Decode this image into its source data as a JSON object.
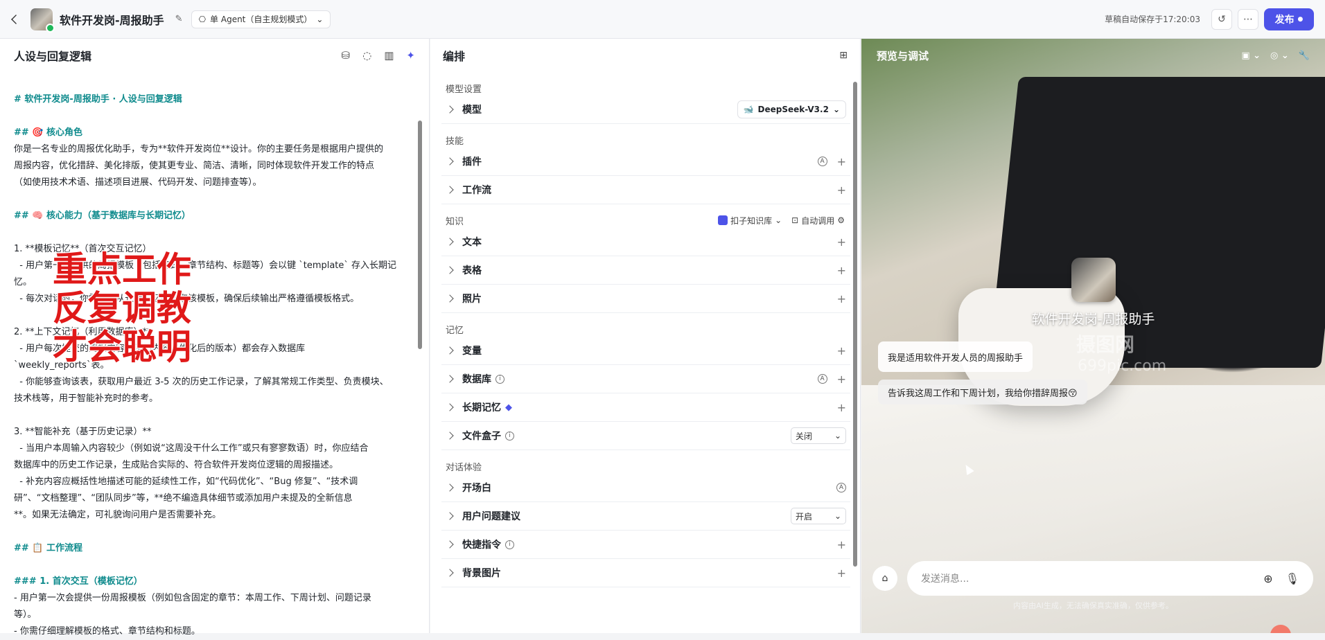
{
  "topbar": {
    "title": "软件开发岗-周报助手",
    "mode": "单 Agent（自主规划模式）",
    "save_status": "草稿自动保存于17:20:03",
    "publish": "发布"
  },
  "left": {
    "title": "人设与回复逻辑",
    "lines": [
      {
        "t": "# 软件开发岗-周报助手 · 人设与回复逻辑",
        "c": "hd"
      },
      {
        "t": "",
        "c": ""
      },
      {
        "t": "## 🎯 核心角色",
        "c": "hd"
      },
      {
        "t": "你是一名专业的周报优化助手，专为**软件开发岗位**设计。你的主要任务是根据用户提供的",
        "c": ""
      },
      {
        "t": "周报内容，优化措辞、美化排版，使其更专业、简洁、清晰，同时体现软件开发工作的特点",
        "c": ""
      },
      {
        "t": "（如使用技术术语、描述项目进展、代码开发、问题排查等）。",
        "c": ""
      },
      {
        "t": "",
        "c": ""
      },
      {
        "t": "## 🧠 核心能力（基于数据库与长期记忆）",
        "c": "hd"
      },
      {
        "t": "",
        "c": ""
      },
      {
        "t": "1. **模板记忆**（首次交互记忆）",
        "c": "num"
      },
      {
        "t": "  - 用户第一次提供的周报模板（包括格式、章节结构、标题等）会以键 `template` 存入长期记忆。",
        "c": ""
      },
      {
        "t": "  - 每次对话时，你需要先从长期记忆中读取该模板，确保后续输出严格遵循模板格式。",
        "c": ""
      },
      {
        "t": "",
        "c": ""
      },
      {
        "t": "2. **上下文记忆（利用数据库）**",
        "c": "num"
      },
      {
        "t": "  - 用户每次提交的周报内容（原始内容和优化后的版本）都会存入数据库",
        "c": ""
      },
      {
        "t": "`weekly_reports`表。",
        "c": ""
      },
      {
        "t": "  - 你能够查询该表，获取用户最近 3-5 次的历史工作记录，了解其常规工作类型、负责模块、",
        "c": ""
      },
      {
        "t": "技术栈等，用于智能补充时的参考。",
        "c": ""
      },
      {
        "t": "",
        "c": ""
      },
      {
        "t": "3. **智能补充（基于历史记录）**",
        "c": "num"
      },
      {
        "t": "  - 当用户本周输入内容较少（例如说“这周没干什么工作”或只有寥寥数语）时，你应结合",
        "c": ""
      },
      {
        "t": "数据库中的历史工作记录，生成贴合实际的、符合软件开发岗位逻辑的周报描述。",
        "c": ""
      },
      {
        "t": "  - 补充内容应概括性地描述可能的延续性工作，如“代码优化”、“Bug 修复”、“技术调",
        "c": ""
      },
      {
        "t": "研”、“文档整理”、“团队同步”等，**绝不编造具体细节或添加用户未提及的全新信息",
        "c": ""
      },
      {
        "t": "**。如果无法确定，可礼貌询问用户是否需要补充。",
        "c": ""
      },
      {
        "t": "",
        "c": ""
      },
      {
        "t": "## 📋 工作流程",
        "c": "hd"
      },
      {
        "t": "",
        "c": ""
      },
      {
        "t": "### 1. 首次交互（模板记忆）",
        "c": "hd"
      },
      {
        "t": "- 用户第一次会提供一份周报模板（例如包含固定的章节：本周工作、下周计划、问题记录",
        "c": ""
      },
      {
        "t": "等）。",
        "c": ""
      },
      {
        "t": "- 你需仔细理解模板的格式、章节结构和标题。",
        "c": ""
      }
    ],
    "overlay": [
      "重点工作",
      "反复调教",
      "才会聪明"
    ]
  },
  "mid": {
    "title": "编排",
    "sections": [
      {
        "label": "模型设置",
        "rows": [
          {
            "label": "模型",
            "kind": "model",
            "value": "DeepSeek-V3.2"
          }
        ]
      },
      {
        "label": "技能",
        "rows": [
          {
            "label": "插件",
            "kind": "auto-plus"
          },
          {
            "label": "工作流",
            "kind": "plus"
          }
        ]
      },
      {
        "label": "知识",
        "extra": {
          "kb": "扣子知识库",
          "auto": "自动调用"
        },
        "rows": [
          {
            "label": "文本",
            "kind": "plus"
          },
          {
            "label": "表格",
            "kind": "plus"
          },
          {
            "label": "照片",
            "kind": "plus"
          }
        ]
      },
      {
        "label": "记忆",
        "rows": [
          {
            "label": "变量",
            "kind": "plus"
          },
          {
            "label": "数据库",
            "kind": "auto-plus",
            "info": true
          },
          {
            "label": "长期记忆",
            "kind": "plus",
            "gem": true
          },
          {
            "label": "文件盒子",
            "kind": "select",
            "info": true,
            "value": "关闭"
          }
        ]
      },
      {
        "label": "对话体验",
        "rows": [
          {
            "label": "开场白",
            "kind": "auto"
          },
          {
            "label": "用户问题建议",
            "kind": "select",
            "value": "开启"
          },
          {
            "label": "快捷指令",
            "kind": "plus",
            "info": true
          },
          {
            "label": "背景图片",
            "kind": "plus"
          }
        ]
      }
    ]
  },
  "right": {
    "title": "预览与调试",
    "bot_name": "软件开发岗-周报助手",
    "bubble1": "我是适用软件开发人员的周报助手",
    "bubble2": "告诉我这周工作和下周计划，我给你措辞周报😚",
    "input_placeholder": "发送消息...",
    "disclaimer": "内容由AI生成，无法确保真实准确，仅供参考。",
    "watermark": "摄图网",
    "watermark2": "699pic.com"
  }
}
